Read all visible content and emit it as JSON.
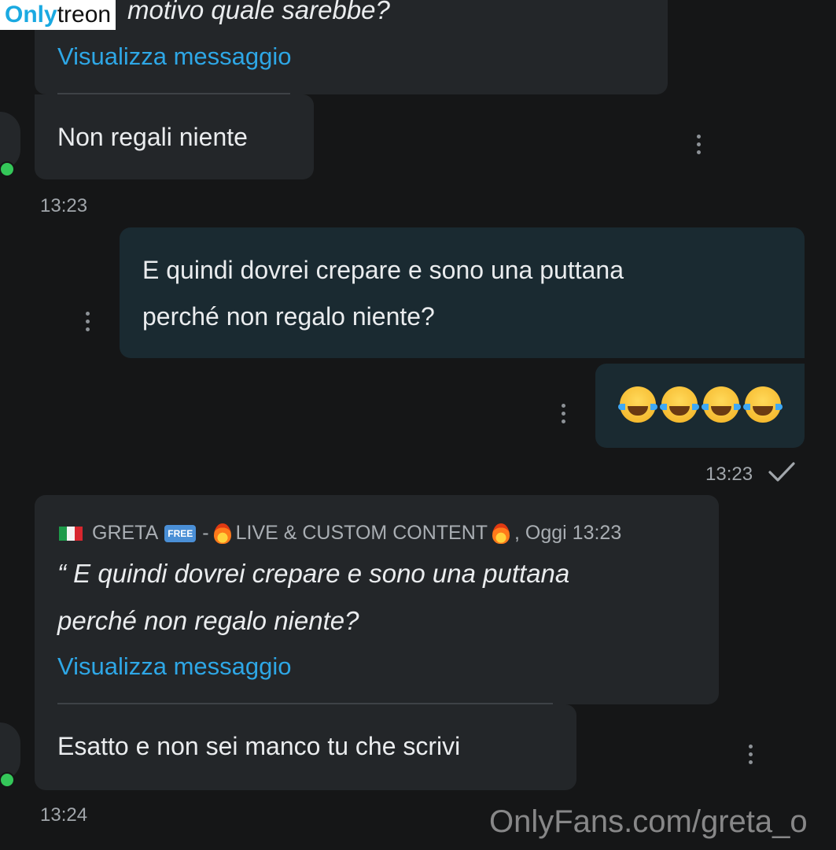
{
  "watermark_logo": {
    "part1": "Only",
    "part2": "treon"
  },
  "watermark_text": "OnlyFans.com/greta_o",
  "messages": [
    {
      "quote_tail": "motivo quale sarebbe?",
      "link": "Visualizza messaggio",
      "reply": "Non regali niente",
      "time": "13:23"
    },
    {
      "text_line1": "E quindi dovrei crepare e sono una puttana",
      "text_line2": "perché non regalo niente?"
    },
    {
      "emoji": "😂😂😂😂",
      "time": "13:23"
    },
    {
      "header": {
        "name": "GRETA",
        "free_badge": "FREE",
        "sep": "-",
        "title": "LIVE & CUSTOM CONTENT",
        "date": ", Oggi 13:23"
      },
      "quote_line1": "“ E quindi dovrei crepare e sono una puttana",
      "quote_line2": "perché non regalo niente?",
      "link": "Visualizza messaggio",
      "reply": "Esatto e non sei manco tu che scrivi",
      "time": "13:24"
    }
  ],
  "colors": {
    "link": "#2ea7e6",
    "online": "#34c759",
    "incoming": "#232629",
    "outgoing": "#1a2a31"
  }
}
